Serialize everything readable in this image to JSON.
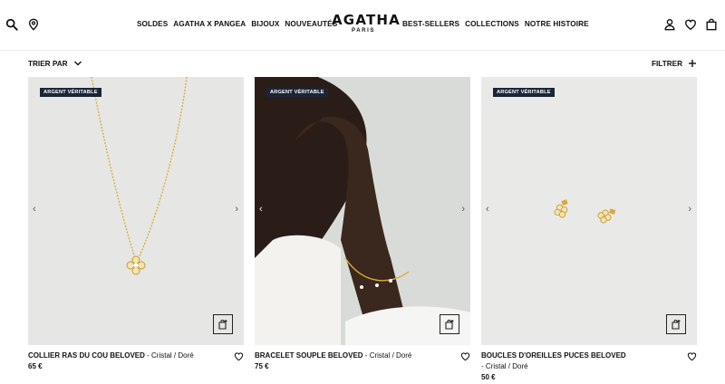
{
  "header": {
    "nav_left": [
      "SOLDES",
      "AGATHA X PANGEA",
      "BIJOUX",
      "NOUVEAUTÉS"
    ],
    "logo": "AGATHA",
    "logo_sub": "PARIS",
    "nav_right": [
      "BEST-SELLERS",
      "COLLECTIONS",
      "NOTRE HISTOIRE"
    ],
    "icons_left": [
      "search-icon",
      "location-pin-icon"
    ],
    "icons_right": [
      "account-icon",
      "wishlist-heart-icon",
      "shopping-bag-icon"
    ]
  },
  "toolbar": {
    "sort_label": "TRIER PAR",
    "filter_label": "FILTRER"
  },
  "products": [
    {
      "badge": "ARGENT VÉRITABLE",
      "name": "COLLIER RAS DU COU BELOVED",
      "variant": " - Cristal / Doré",
      "price": "65 €",
      "image": "gold-necklace-flower-pendant"
    },
    {
      "badge": "ARGENT VÉRITABLE",
      "name": "BRACELET SOUPLE BELOVED",
      "variant": " - Cristal / Doré",
      "price": "75 €",
      "image": "model-wearing-gold-bracelet"
    },
    {
      "badge": "ARGENT VÉRITABLE",
      "name": "BOUCLES D'OREILLES PUCES BELOVED",
      "variant": " - Cristal / Doré",
      "price": "50 €",
      "image": "gold-flower-stud-earrings"
    }
  ],
  "colors": {
    "badge_bg": "#1b2537",
    "text": "#111111",
    "gold": "#d9a93a"
  }
}
